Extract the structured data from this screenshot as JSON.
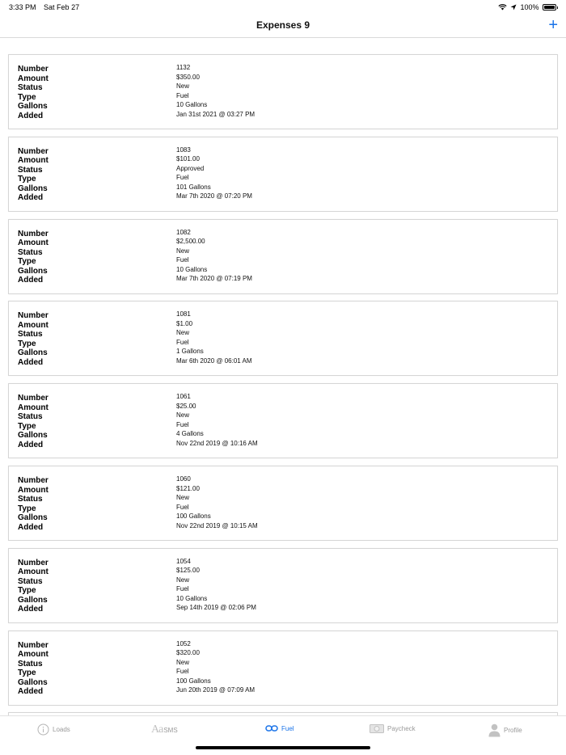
{
  "status_bar": {
    "time": "3:33 PM",
    "date": "Sat Feb 27",
    "battery": "100%"
  },
  "nav": {
    "title": "Expenses 9",
    "add_label": "+"
  },
  "labels": {
    "number": "Number",
    "amount": "Amount",
    "status": "Status",
    "type": "Type",
    "gallons": "Gallons",
    "added": "Added"
  },
  "expenses": [
    {
      "number": "1132",
      "amount": "$350.00",
      "status": "New",
      "type": "Fuel",
      "gallons": "10 Gallons",
      "added": "Jan 31st 2021 @ 03:27 PM"
    },
    {
      "number": "1083",
      "amount": "$101.00",
      "status": "Approved",
      "type": "Fuel",
      "gallons": "101 Gallons",
      "added": "Mar 7th 2020 @ 07:20 PM"
    },
    {
      "number": "1082",
      "amount": "$2,500.00",
      "status": "New",
      "type": "Fuel",
      "gallons": "10 Gallons",
      "added": "Mar 7th 2020 @ 07:19 PM"
    },
    {
      "number": "1081",
      "amount": "$1.00",
      "status": "New",
      "type": "Fuel",
      "gallons": "1 Gallons",
      "added": "Mar 6th 2020 @ 06:01 AM"
    },
    {
      "number": "1061",
      "amount": "$25.00",
      "status": "New",
      "type": "Fuel",
      "gallons": "4 Gallons",
      "added": "Nov 22nd 2019 @ 10:16 AM"
    },
    {
      "number": "1060",
      "amount": "$121.00",
      "status": "New",
      "type": "Fuel",
      "gallons": "100 Gallons",
      "added": "Nov 22nd 2019 @ 10:15 AM"
    },
    {
      "number": "1054",
      "amount": "$125.00",
      "status": "New",
      "type": "Fuel",
      "gallons": "10 Gallons",
      "added": "Sep 14th 2019 @ 02:06 PM"
    },
    {
      "number": "1052",
      "amount": "$320.00",
      "status": "New",
      "type": "Fuel",
      "gallons": "100 Gallons",
      "added": "Jun 20th 2019 @ 07:09 AM"
    }
  ],
  "tabs": [
    {
      "label": "Loads",
      "icon": "info-circle-icon",
      "active": false
    },
    {
      "label": "SMS",
      "icon": "text-aa-icon",
      "active": false
    },
    {
      "label": "Fuel",
      "icon": "link-icon",
      "active": true
    },
    {
      "label": "Paycheck",
      "icon": "money-icon",
      "active": false
    },
    {
      "label": "Profile",
      "icon": "person-icon",
      "active": false
    }
  ],
  "colors": {
    "accent": "#1a73e8",
    "inactive_tab": "#9a9a9a",
    "card_border": "#d6d6d6"
  }
}
